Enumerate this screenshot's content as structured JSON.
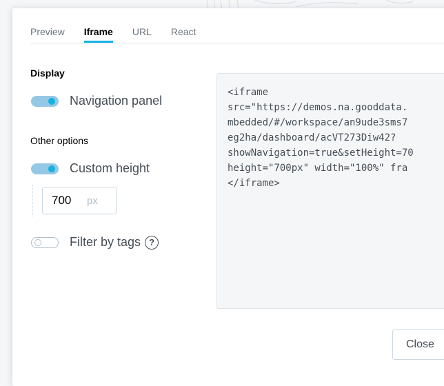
{
  "tabs": [
    {
      "label": "Preview"
    },
    {
      "label": "Iframe"
    },
    {
      "label": "URL"
    },
    {
      "label": "React"
    }
  ],
  "display": {
    "title": "Display",
    "navigation_panel": {
      "label": "Navigation panel",
      "enabled": true
    }
  },
  "other_options": {
    "title": "Other options",
    "custom_height": {
      "label": "Custom height",
      "enabled": true
    },
    "height_value": "700",
    "height_unit": "px",
    "filter_by_tags": {
      "label": "Filter by tags",
      "enabled": false,
      "help": "?"
    }
  },
  "code": "<iframe\nsrc=\"https://demos.na.gooddata.\nmbedded/#/workspace/an9ude3sms7\neg2ha/dashboard/acVT273Diw42?\nshowNavigation=true&setHeight=70\nheight=\"700px\" width=\"100%\" fra\n</iframe>",
  "footer": {
    "close_label": "Close"
  },
  "colors": {
    "accent": "#14b2e2",
    "toggle_track": "#94c8e4"
  }
}
